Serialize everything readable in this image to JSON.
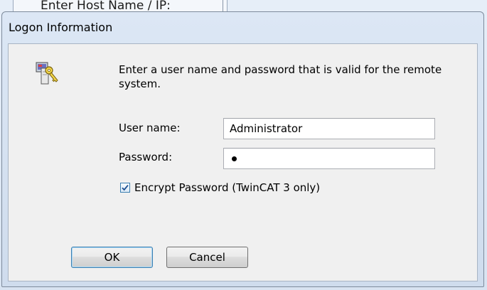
{
  "background_window": {
    "title": "Enter Host Name / IP:"
  },
  "dialog": {
    "title": "Logon Information",
    "icon": "key-icon",
    "prompt": "Enter a user name and password that is valid for the remote system.",
    "username": {
      "label": "User name:",
      "value": "Administrator"
    },
    "password": {
      "label": "Password:",
      "masked_length": 1
    },
    "encrypt": {
      "label": "Encrypt Password (TwinCAT 3 only)",
      "checked": true
    },
    "buttons": {
      "ok": "OK",
      "cancel": "Cancel"
    }
  },
  "colors": {
    "frame": "#cfdced",
    "client": "#f0f0f0",
    "focus_border": "#3c7fb1"
  }
}
